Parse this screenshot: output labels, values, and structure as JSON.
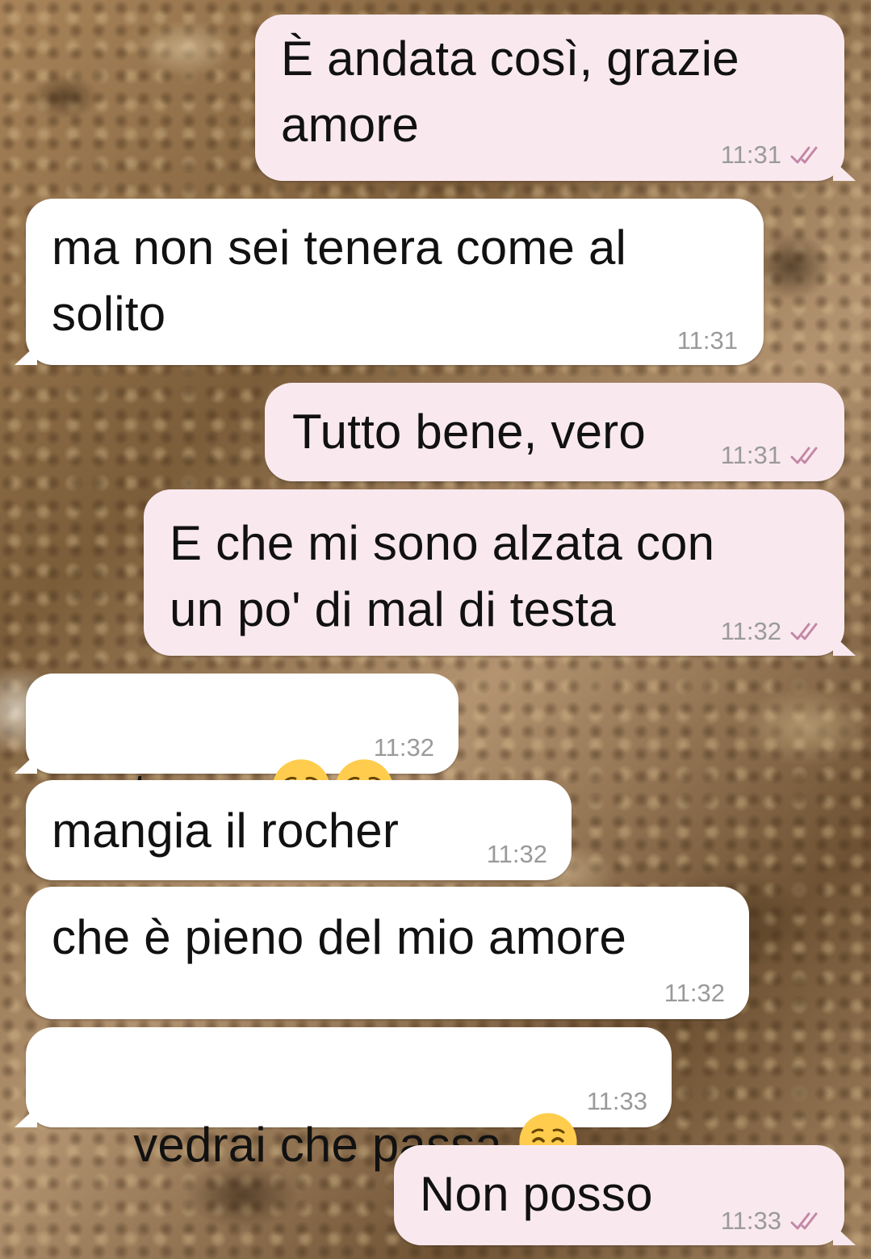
{
  "accent": {
    "outgoing_bubble": "#f9e9ef",
    "incoming_bubble": "#ffffff",
    "tick_color": "#c487a6",
    "time_color": "#9a9a9a"
  },
  "messages": [
    {
      "direction": "out",
      "text": "È andata così, grazie\namore",
      "time": "11:31",
      "ticks": "double-check-icon"
    },
    {
      "direction": "in",
      "text": "ma non sei tenera come al\nsolito",
      "time": "11:31"
    },
    {
      "direction": "out",
      "text": "Tutto bene, vero",
      "time": "11:31",
      "ticks": "double-check-icon"
    },
    {
      "direction": "out",
      "text": "E che mi sono alzata con\nun po' di mal di testa",
      "time": "11:32",
      "ticks": "double-check-icon"
    },
    {
      "direction": "in",
      "text": "tesoro",
      "emoji": [
        "pensive-face-emoji",
        "pensive-face-emoji"
      ],
      "time": "11:32"
    },
    {
      "direction": "in",
      "text": "mangia il rocher",
      "time": "11:32"
    },
    {
      "direction": "in",
      "text": "che è pieno del mio amore",
      "time": "11:32"
    },
    {
      "direction": "in",
      "text": "vedrai che passa ",
      "emoji": [
        "smiling-face-emoji"
      ],
      "time": "11:33"
    },
    {
      "direction": "out",
      "text": "Non posso",
      "time": "11:33",
      "ticks": "double-check-icon"
    }
  ]
}
